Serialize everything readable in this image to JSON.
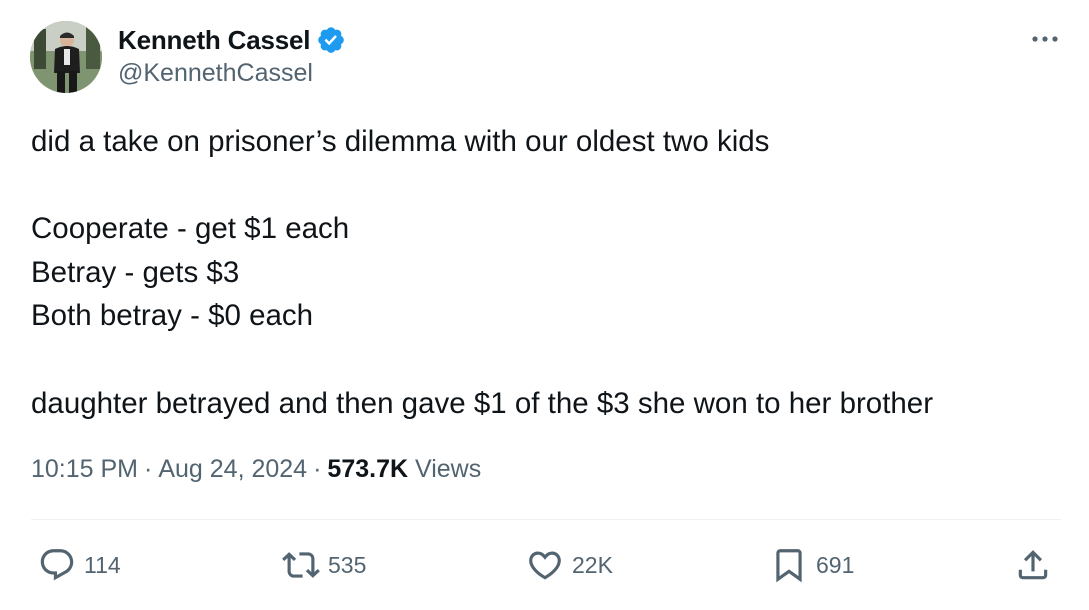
{
  "author": {
    "display_name": "Kenneth Cassel",
    "handle": "@KennethCassel",
    "verified": true
  },
  "tweet": {
    "lines": [
      "did a take on prisoner’s dilemma with our oldest two kids",
      "",
      "Cooperate - get $1 each",
      "Betray - gets $3",
      "Both betray - $0 each",
      "",
      "daughter betrayed and then gave $1 of the $3 she won to her brother"
    ],
    "time": "10:15 PM",
    "date": "Aug 24, 2024",
    "separator": "·",
    "views_count": "573.7K",
    "views_label": "Views"
  },
  "actions": {
    "replies": "114",
    "reposts": "535",
    "likes": "22K",
    "bookmarks": "691"
  },
  "colors": {
    "text_primary": "#0f1419",
    "text_secondary": "#536471",
    "verified_blue": "#1d9bf0",
    "divider": "#eff3f4"
  },
  "icons": [
    "verified-badge-icon",
    "more-icon",
    "reply-icon",
    "repost-icon",
    "like-icon",
    "bookmark-icon",
    "share-icon"
  ]
}
